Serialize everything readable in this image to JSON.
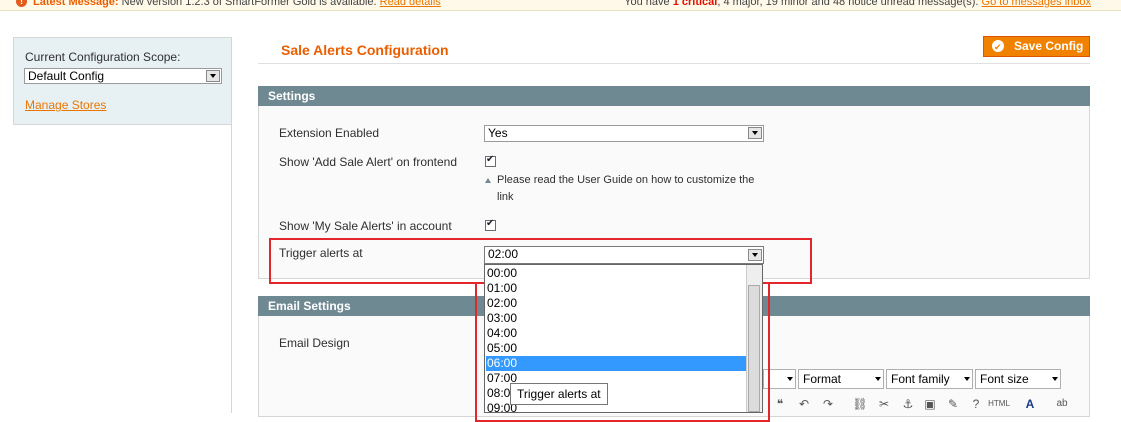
{
  "notification": {
    "label": "Latest Message:",
    "text": "New version 1.2.3 of SmartFormer Gold is available.",
    "read_details": "Read details",
    "summary_prefix": "You have",
    "critical_count": "1 critical",
    "major": "4 major",
    "minor": "19 minor",
    "notice": "48 notice",
    "summary_suffix": "unread message(s).",
    "inbox_link": "Go to messages inbox"
  },
  "scope": {
    "label": "Current Configuration Scope:",
    "selected": "Default Config",
    "manage_stores": "Manage Stores"
  },
  "page": {
    "title": "Sale Alerts Configuration",
    "save_button": "Save Config"
  },
  "settings": {
    "header": "Settings",
    "extension_enabled_label": "Extension Enabled",
    "extension_enabled_value": "Yes",
    "add_alert_label": "Show 'Add Sale Alert' on frontend",
    "add_alert_checked": true,
    "note": "Please read the User Guide on how to customize the link",
    "my_alerts_label": "Show 'My Sale Alerts' in account",
    "my_alerts_checked": true,
    "trigger_label": "Trigger alerts at",
    "trigger_value": "02:00",
    "trigger_options": [
      "00:00",
      "01:00",
      "02:00",
      "03:00",
      "04:00",
      "05:00",
      "06:00",
      "07:00",
      "08:00",
      "09:00"
    ],
    "highlighted_option": "06:00"
  },
  "email_settings": {
    "header": "Email Settings",
    "email_design_label": "Email Design",
    "editor_format": "Format",
    "editor_font_family": "Font family",
    "editor_font_size": "Font size"
  },
  "tooltip": "Trigger alerts at",
  "colors": {
    "accent_orange": "#eb5e00",
    "section_header": "#6f8992",
    "highlight_red": "#e3262c",
    "option_highlight": "#3399ff"
  }
}
